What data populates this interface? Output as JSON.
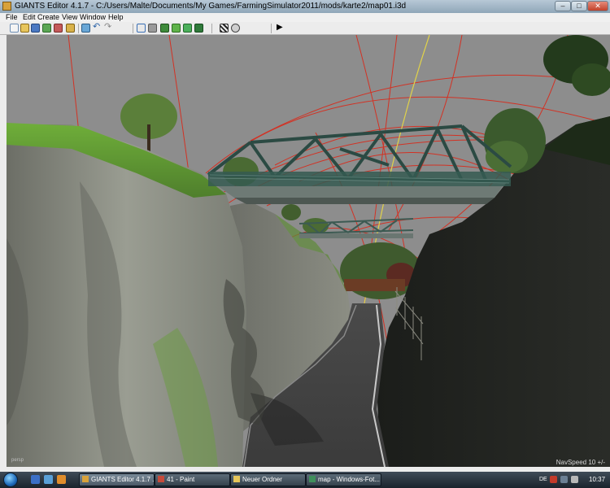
{
  "window": {
    "title": "GIANTS Editor 4.1.7 - C:/Users/Malte/Documents/My Games/FarmingSimulator2011/mods/karte2/map01.i3d"
  },
  "menu": [
    "File",
    "Edit",
    "Create",
    "View",
    "Window",
    "Help"
  ],
  "toolbar": {
    "icons": [
      "new-file-icon",
      "open-file-icon",
      "save-icon",
      "import-icon",
      "export-icon",
      "select-icon",
      "undo-icon",
      "redo-icon",
      "terrain-icon",
      "foliage-icon",
      "landscape-icon",
      "grass-icon",
      "paint-icon",
      "plant-icon",
      "checker-icon",
      "navigation-icon",
      "play-icon"
    ]
  },
  "viewport": {
    "camera_label": "persp",
    "nav_speed": "NavSpeed 10 +/-"
  },
  "taskbar": {
    "tasks": [
      {
        "label": "GIANTS Editor 4.1.7 ...",
        "icon": "giants-editor-icon",
        "active": true
      },
      {
        "label": "41 - Paint",
        "icon": "paint-app-icon",
        "active": false
      },
      {
        "label": "Neuer Ordner",
        "icon": "folder-icon",
        "active": false
      },
      {
        "label": "map - Windows-Fot...",
        "icon": "photo-viewer-icon",
        "active": false
      }
    ],
    "language": "DE",
    "clock": "10:37"
  },
  "colors": {
    "titlebar": "#a3b7c7",
    "spline_red": "#e23b2e",
    "spline_yellow": "#e0d24a",
    "bridge_green": "#2b4a43",
    "sky": "#8d8d8d"
  }
}
